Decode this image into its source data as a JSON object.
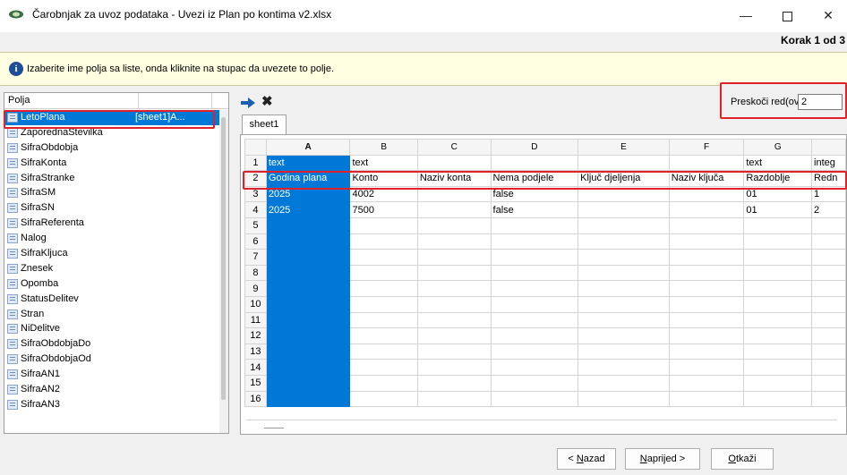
{
  "window": {
    "title": "Čarobnjak za uvoz podataka - Uvezi iz Plan po kontima v2.xlsx",
    "step": "Korak 1 od 3",
    "minimize_icon": "minimize-icon",
    "maximize_icon": "maximize-icon",
    "close_icon": "close-icon"
  },
  "info": {
    "icon": "info-icon",
    "text": "Izaberite ime polja sa liste, onda kliknite na stupac da uvezete to polje."
  },
  "fields_panel": {
    "header": "Polja",
    "items": [
      {
        "label": "LetoPlana",
        "sheet": "[sheet1]A...",
        "selected": true
      },
      {
        "label": "ZaporednaStevilka"
      },
      {
        "label": "SifraObdobja"
      },
      {
        "label": "SifraKonta"
      },
      {
        "label": "SifraStranke"
      },
      {
        "label": "SifraSM"
      },
      {
        "label": "SifraSN"
      },
      {
        "label": "SifraReferenta"
      },
      {
        "label": "Nalog"
      },
      {
        "label": "SifraKljuca"
      },
      {
        "label": "Znesek"
      },
      {
        "label": "Opomba"
      },
      {
        "label": "StatusDelitev"
      },
      {
        "label": "Stran"
      },
      {
        "label": "NiDelitve"
      },
      {
        "label": "SifraObdobjaDo"
      },
      {
        "label": "SifraObdobjaOd"
      },
      {
        "label": "SifraAN1"
      },
      {
        "label": "SifraAN2"
      },
      {
        "label": "SifraAN3"
      }
    ]
  },
  "toolbar": {
    "assign_icon": "arrow-right-icon",
    "remove_icon": "remove-x-icon"
  },
  "skip_rows": {
    "label": "Preskoči red(ove)",
    "value": "2"
  },
  "sheet_tab": "sheet1",
  "grid": {
    "columns": [
      "A",
      "B",
      "C",
      "D",
      "E",
      "F",
      "G",
      ""
    ],
    "rows": [
      {
        "num": "1",
        "cells": [
          "text",
          "text",
          "",
          "",
          "",
          "",
          "text",
          "integ"
        ]
      },
      {
        "num": "2",
        "cells": [
          "Godina plana",
          "Konto",
          "Naziv konta",
          "Nema podjele",
          "Ključ djeljenja",
          "Naziv ključa",
          "Razdoblje",
          "Redn"
        ]
      },
      {
        "num": "3",
        "cells": [
          "2025",
          "4002",
          "",
          "false",
          "",
          "",
          "01",
          "1"
        ]
      },
      {
        "num": "4",
        "cells": [
          "2025",
          "7500",
          "",
          "false",
          "",
          "",
          "01",
          "2"
        ]
      },
      {
        "num": "5",
        "cells": [
          "",
          "",
          "",
          "",
          "",
          "",
          "",
          ""
        ]
      },
      {
        "num": "6",
        "cells": [
          "",
          "",
          "",
          "",
          "",
          "",
          "",
          ""
        ]
      },
      {
        "num": "7",
        "cells": [
          "",
          "",
          "",
          "",
          "",
          "",
          "",
          ""
        ]
      },
      {
        "num": "8",
        "cells": [
          "",
          "",
          "",
          "",
          "",
          "",
          "",
          ""
        ]
      },
      {
        "num": "9",
        "cells": [
          "",
          "",
          "",
          "",
          "",
          "",
          "",
          ""
        ]
      },
      {
        "num": "10",
        "cells": [
          "",
          "",
          "",
          "",
          "",
          "",
          "",
          ""
        ]
      },
      {
        "num": "11",
        "cells": [
          "",
          "",
          "",
          "",
          "",
          "",
          "",
          ""
        ]
      },
      {
        "num": "12",
        "cells": [
          "",
          "",
          "",
          "",
          "",
          "",
          "",
          ""
        ]
      },
      {
        "num": "13",
        "cells": [
          "",
          "",
          "",
          "",
          "",
          "",
          "",
          ""
        ]
      },
      {
        "num": "14",
        "cells": [
          "",
          "",
          "",
          "",
          "",
          "",
          "",
          ""
        ]
      },
      {
        "num": "15",
        "cells": [
          "",
          "",
          "",
          "",
          "",
          "",
          "",
          ""
        ]
      },
      {
        "num": "16",
        "cells": [
          "",
          "",
          "",
          "",
          "",
          "",
          "",
          ""
        ]
      }
    ]
  },
  "buttons": {
    "back": {
      "accel": "N",
      "rest": "azad",
      "prefix": "< "
    },
    "next": {
      "accel": "N",
      "rest": "aprijed >"
    },
    "cancel": {
      "accel": "O",
      "rest": "tkaži"
    }
  },
  "colors": {
    "selection": "#0078d7",
    "highlight_border": "#e0202a",
    "info_bg": "#ffffe1"
  }
}
